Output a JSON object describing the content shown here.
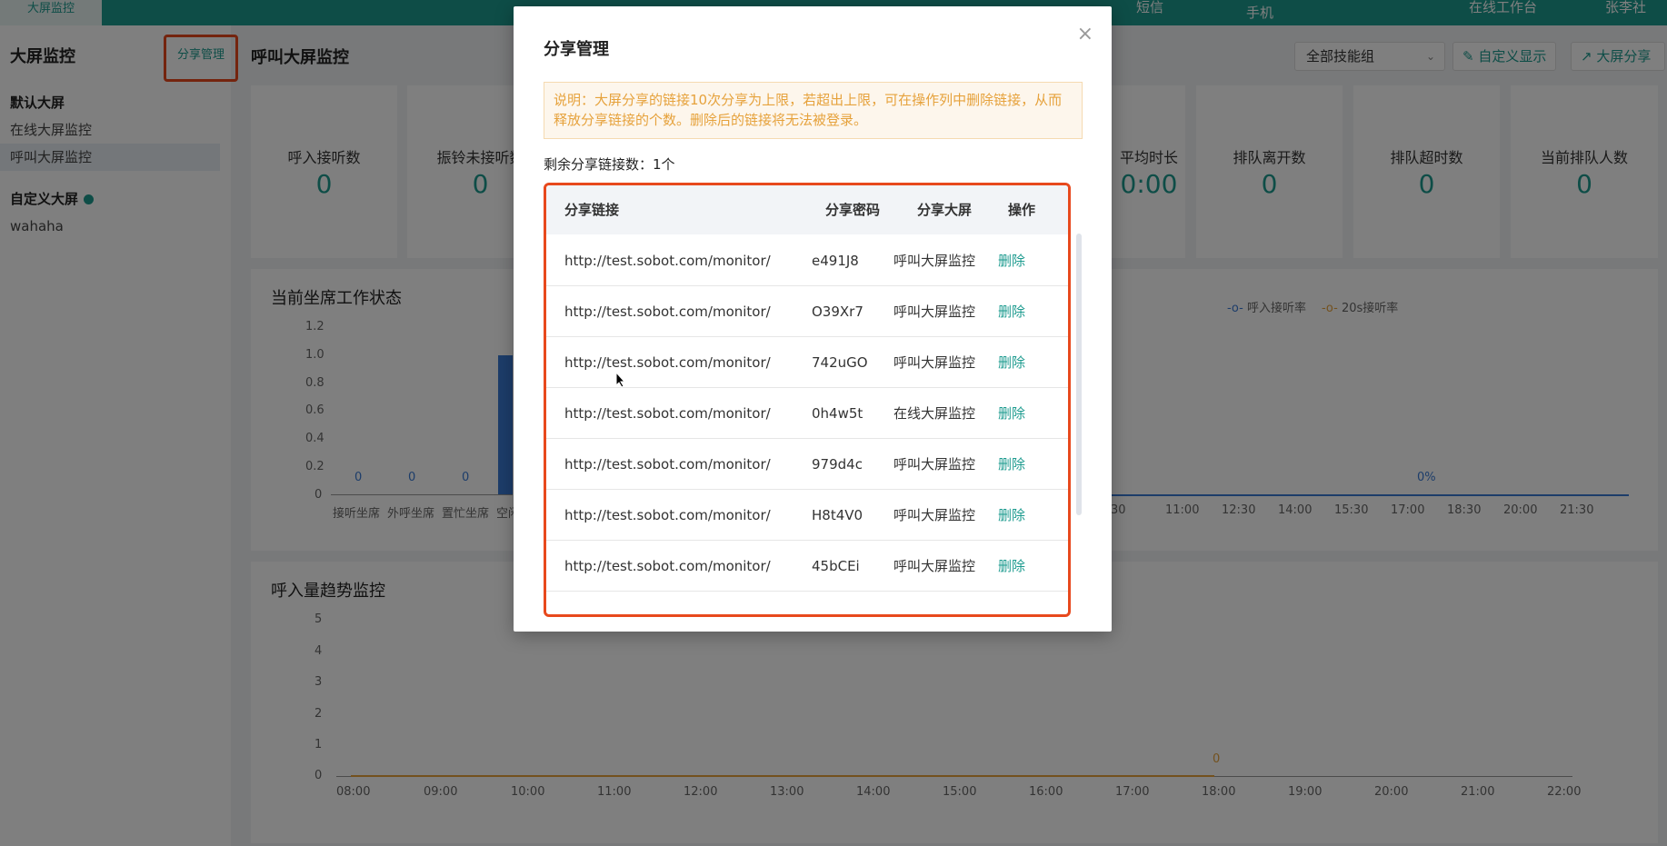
{
  "topbar": {
    "active_tab": "大屏监控",
    "sms": "短信",
    "phone": "手机",
    "workbench": "在线工作台",
    "user": "张李社"
  },
  "sidebar": {
    "title": "大屏监控",
    "share_button": "分享管理",
    "default_group": "默认大屏",
    "items": [
      "在线大屏监控",
      "呼叫大屏监控"
    ],
    "custom_group": "自定义大屏",
    "custom_items": [
      "wahaha"
    ]
  },
  "main": {
    "title": "呼叫大屏监控",
    "skill_select": "全部技能组",
    "custom_display_btn": "自定义显示",
    "share_btn": "大屏分享",
    "stats": [
      {
        "label": "呼入接听数",
        "value": "0"
      },
      {
        "label": "振铃未接听数",
        "value": "0"
      },
      {
        "label": "平均时长",
        "value": "0:00"
      },
      {
        "label": "排队离开数",
        "value": "0"
      },
      {
        "label": "排队超时数",
        "value": "0"
      },
      {
        "label": "当前排队人数",
        "value": "0"
      }
    ],
    "status_panel": {
      "title": "当前坐席工作状态",
      "y_ticks": [
        "1.2",
        "1.0",
        "0.8",
        "0.6",
        "0.4",
        "0.2",
        "0"
      ],
      "x_labels": [
        "接听坐席",
        "外呼坐席",
        "置忙坐席",
        "空闲"
      ],
      "value_labels": [
        "0",
        "0",
        "0"
      ],
      "legend": [
        "呼入接听率",
        "20s接听率"
      ],
      "right_x_labels": [
        "30",
        "11:00",
        "12:30",
        "14:00",
        "15:30",
        "17:00",
        "18:30",
        "20:00",
        "21:30"
      ],
      "pct_label": "0%"
    },
    "trend_panel": {
      "title": "呼入量趋势监控",
      "y_ticks": [
        "5",
        "4",
        "3",
        "2",
        "1",
        "0"
      ],
      "x_labels": [
        "08:00",
        "09:00",
        "10:00",
        "11:00",
        "12:00",
        "13:00",
        "14:00",
        "15:00",
        "16:00",
        "17:00",
        "18:00",
        "19:00",
        "20:00",
        "21:00",
        "22:00"
      ],
      "point_label": "0"
    }
  },
  "modal": {
    "title": "分享管理",
    "notice": "说明：大屏分享的链接10次分享为上限，若超出上限，可在操作列中删除链接，从而释放分享链接的个数。删除后的链接将无法被登录。",
    "remaining": "剩余分享链接数：1个",
    "columns": [
      "分享链接",
      "分享密码",
      "分享大屏",
      "操作"
    ],
    "rows": [
      {
        "link": "http://test.sobot.com/monitor/",
        "password": "e491J8",
        "screen": "呼叫大屏监控",
        "action": "删除"
      },
      {
        "link": "http://test.sobot.com/monitor/",
        "password": "O39Xr7",
        "screen": "呼叫大屏监控",
        "action": "删除"
      },
      {
        "link": "http://test.sobot.com/monitor/",
        "password": "742uGO",
        "screen": "呼叫大屏监控",
        "action": "删除"
      },
      {
        "link": "http://test.sobot.com/monitor/",
        "password": "0h4w5t",
        "screen": "在线大屏监控",
        "action": "删除"
      },
      {
        "link": "http://test.sobot.com/monitor/",
        "password": "979d4c",
        "screen": "呼叫大屏监控",
        "action": "删除"
      },
      {
        "link": "http://test.sobot.com/monitor/",
        "password": "H8t4V0",
        "screen": "呼叫大屏监控",
        "action": "删除"
      },
      {
        "link": "http://test.sobot.com/monitor/",
        "password": "45bCEi",
        "screen": "呼叫大屏监控",
        "action": "删除"
      }
    ]
  }
}
